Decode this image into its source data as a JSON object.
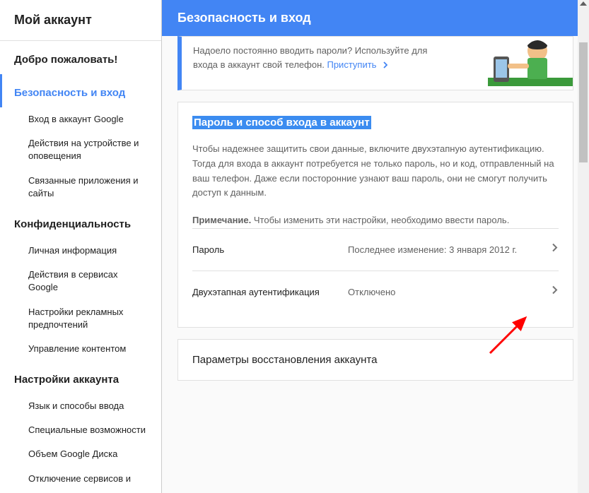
{
  "sidebar": {
    "title": "Мой аккаунт",
    "sections": [
      {
        "heading": "Добро пожаловать!",
        "active": false,
        "items": []
      },
      {
        "heading": "Безопасность и вход",
        "active": true,
        "items": [
          "Вход в аккаунт Google",
          "Действия на устройстве и оповещения",
          "Связанные приложения и сайты"
        ]
      },
      {
        "heading": "Конфиденциальность",
        "active": false,
        "items": [
          "Личная информация",
          "Действия в сервисах Google",
          "Настройки рекламных предпочтений",
          "Управление контентом"
        ]
      },
      {
        "heading": "Настройки аккаунта",
        "active": false,
        "items": [
          "Язык и способы ввода",
          "Специальные возможности",
          "Объем Google Диска",
          "Отключение сервисов и"
        ]
      }
    ]
  },
  "header": {
    "title": "Безопасность и вход"
  },
  "promo": {
    "text_line1": "Надоело постоянно вводить пароли? Используйте для",
    "text_line2": "входа в аккаунт свой телефон. ",
    "link": "Приступить"
  },
  "password_card": {
    "title": "Пароль и способ входа в аккаунт",
    "description": "Чтобы надежнее защитить свои данные, включите двухэтапную аутентификацию. Тогда для входа в аккаунт потребуется не только пароль, но и код, отправленный на ваш телефон. Даже если посторонние узнают ваш пароль, они не смогут получить доступ к данным.",
    "note_label": "Примечание.",
    "note_text": " Чтобы изменить эти настройки, необходимо ввести пароль.",
    "rows": [
      {
        "label": "Пароль",
        "value": "Последнее изменение: 3 января 2012 г."
      },
      {
        "label": "Двухэтапная аутентификация",
        "value": "Отключено"
      }
    ]
  },
  "recovery_card": {
    "title": "Параметры восстановления аккаунта"
  }
}
